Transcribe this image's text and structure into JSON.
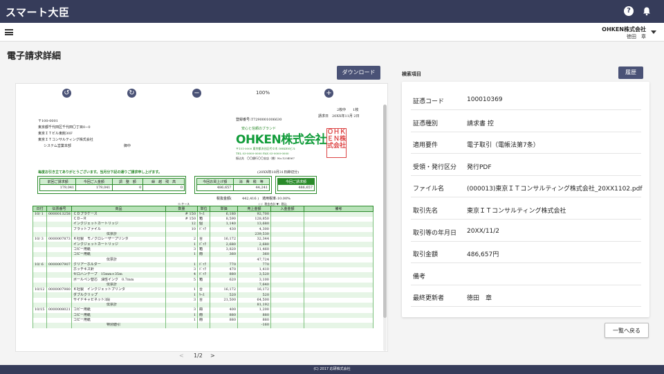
{
  "app": {
    "title": "スマート大臣"
  },
  "header": {
    "company": "OHKEN株式会社",
    "user": "徳田　章"
  },
  "page": {
    "title": "電子請求詳細"
  },
  "buttons": {
    "download": "ダウンロード",
    "history": "履歴",
    "back": "一覧へ戻る"
  },
  "viewer": {
    "zoom": "100%",
    "page_indicator": "1/2",
    "prev": "<",
    "next": ">",
    "invoice": {
      "page_info": "2枚中　　1枚",
      "date": "請求日　20XX年11月 2日",
      "postal": "〒100-0001",
      "address": "東京都千代田区千代田〇丁目0−0",
      "building": "東京ＩＴビル東館30F",
      "customer": "東京ＩＴコンサルティング株式会社",
      "department": "システム営業本部",
      "honorific": "御中",
      "reg_number": "登録番号:T7290001006630",
      "slogan": "安心と信頼のブランド",
      "issuer": "OHKEN株式会社",
      "issuer_address": "〒151-0000 東京都渋谷区代々木 OHKENビル",
      "issuer_tel": "TEL 03-0000-0000 FAX 03-0000-0000",
      "bank": "振込先　〇〇銀行〇〇支店（普）No.1234567",
      "seal": "ＯＨＫＥＮ株式会社",
      "greeting": "毎度お引き立てありがとうございます。当月分下記の通りご請求申し上げます。",
      "closing": "(20XX年10月31日締切分)",
      "summary_headers": [
        "前回ご請求額",
        "今回ご入金額",
        "調　整　額",
        "繰　越　残　高"
      ],
      "summary_values": [
        "179,041",
        "179,041",
        "0",
        "0"
      ],
      "sales_headers": [
        "今回お買上げ額",
        "消　費　税　等"
      ],
      "sales_values": [
        "486,657",
        "44,241"
      ],
      "total_header": "今回ご請求額",
      "total_value": "486,657",
      "tax_line": "税抜金額(　　　442,416 )　適用税率:10.00%",
      "unit_note": "※:ケース",
      "tax_note": "( )：税金合計 ▼：税込",
      "columns": [
        "日付",
        "伝票番号",
        "商品",
        "数量",
        "単位",
        "単価",
        "売上金額",
        "入金金額",
        "備考"
      ],
      "rows": [
        [
          "10/ 1",
          "0000013258",
          "ＣＤプラケース",
          "# 150",
          "ｹｰｽ",
          "6,180",
          "92,700",
          "",
          ""
        ],
        [
          "",
          "",
          "ＣＤ−Ｒ",
          "# 150",
          "箱",
          "8,590",
          "128,850",
          "",
          ""
        ],
        [
          "",
          "",
          "インクジェットカートリッジ",
          "12",
          "個",
          "1,140",
          "13,680",
          "",
          ""
        ],
        [
          "",
          "",
          "フラットファイル",
          "10",
          "ﾊﾟｯｸ",
          "430",
          "4,300",
          "",
          ""
        ],
        [
          "",
          "",
          "伝票計",
          "",
          "",
          "",
          "239,530",
          "",
          ""
        ],
        [
          "10/ 3",
          "0000007873",
          "Ｋ社製　モノクロレーザープリンタ",
          "2",
          "台",
          "16,172",
          "32,344",
          "",
          ""
        ],
        [
          "",
          "",
          "インクジェットカートリッジ",
          "1",
          "ﾊﾟｯｸ",
          "2,680",
          "2,680",
          "",
          ""
        ],
        [
          "",
          "",
          "コピー用紙",
          "3",
          "箱",
          "3,820",
          "11,460",
          "",
          ""
        ],
        [
          "",
          "",
          "コピー用紙",
          "1",
          "冊",
          "360",
          "360",
          "",
          ""
        ],
        [
          "",
          "",
          "伝票計",
          "",
          "",
          "",
          "47,724",
          "",
          ""
        ],
        [
          "10/ 6",
          "0000007907",
          "クリアーホルダー",
          "1",
          "ﾊﾟｯｸ",
          "770",
          "770",
          "",
          ""
        ],
        [
          "",
          "",
          "ホッチキス針",
          "3",
          "ﾊﾟｯｸ",
          "470",
          "1,410",
          "",
          ""
        ],
        [
          "",
          "",
          "セロハンテープ　15mm×35m",
          "4",
          "ﾊﾟｯｸ",
          "880",
          "3,520",
          "",
          ""
        ],
        [
          "",
          "",
          "ボールペン替芯　油性インク　0.7mm",
          "5",
          "箱",
          "620",
          "3,100",
          "",
          ""
        ],
        [
          "",
          "",
          "伝票計",
          "",
          "",
          "",
          "7,640",
          "",
          ""
        ],
        [
          "10/12",
          "0000007980",
          "Ｋ社製　インクジェットプリンタ",
          "1",
          "台",
          "16,172",
          "16,172",
          "",
          ""
        ],
        [
          "",
          "",
          "ダブルクリップ",
          "1",
          "ｹｰｽ",
          "520",
          "520",
          "",
          ""
        ],
        [
          "",
          "",
          "サイドキャビネット3段",
          "3",
          "台",
          "21,500",
          "64,500",
          "",
          ""
        ],
        [
          "",
          "",
          "伝票計",
          "",
          "",
          "",
          "81,192",
          "",
          ""
        ],
        [
          "10/15",
          "0000008021",
          "コピー用紙",
          "3",
          "冊",
          "400",
          "1,200",
          "",
          ""
        ],
        [
          "",
          "",
          "コピー用紙",
          "1",
          "冊",
          "880",
          "880",
          "",
          ""
        ],
        [
          "",
          "",
          "コピー用紙",
          "1",
          "冊",
          "880",
          "880",
          "",
          ""
        ],
        [
          "",
          "",
          "特別値引",
          "",
          "",
          "",
          "-160",
          "",
          ""
        ]
      ]
    }
  },
  "search": {
    "label": "検索項目",
    "items": [
      {
        "label": "証憑コード",
        "value": "100010369"
      },
      {
        "label": "証憑種別",
        "value": "請求書 控"
      },
      {
        "label": "適用要件",
        "value": "電子取引（電帳法第7条）"
      },
      {
        "label": "受領・発行区分",
        "value": "発行PDF"
      },
      {
        "label": "ファイル名",
        "value": "(000013)東京ＩＴコンサルティング株式会社_20XX1102.pdf"
      },
      {
        "label": "取引先名",
        "value": "東京ＩＴコンサルティング株式会社"
      },
      {
        "label": "取引等の年月日",
        "value": "20XX/11/2"
      },
      {
        "label": "取引金額",
        "value": "486,657円"
      },
      {
        "label": "備考",
        "value": ""
      },
      {
        "label": "最終更新者",
        "value": "徳田　章"
      }
    ]
  },
  "footer": {
    "copyright": "(C) 2017 応研株式会社"
  }
}
